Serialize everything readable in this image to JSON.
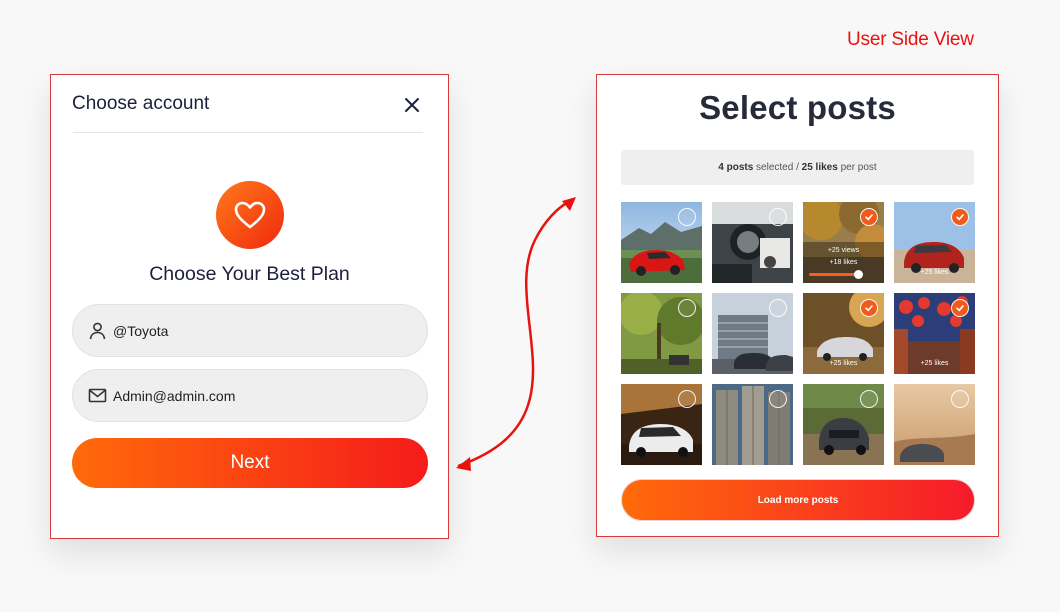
{
  "page": {
    "view_label": "User Side View"
  },
  "account_modal": {
    "title": "Choose account",
    "close_icon": "close-icon",
    "heart_icon": "heart-icon",
    "plan_heading": "Choose Your Best Plan",
    "username_value": "@Toyota",
    "username_icon": "user-icon",
    "email_value": "Admin@admin.com",
    "email_icon": "mail-icon",
    "next_label": "Next",
    "accent_gradient": [
      "#ff6a0a",
      "#f51b1b"
    ]
  },
  "posts_panel": {
    "title": "Select posts",
    "summary": {
      "count": "4 posts",
      "selected_word": " selected / ",
      "likes": "25 likes",
      "per_post": " per post"
    },
    "posts": [
      {
        "selected": false,
        "scene": "red sports car by lake",
        "caption": ""
      },
      {
        "selected": false,
        "scene": "car interior",
        "caption": ""
      },
      {
        "selected": true,
        "scene": "autumn trees",
        "views": "+25 views",
        "likes": "+18 likes",
        "slider": 0.9
      },
      {
        "selected": true,
        "scene": "red SUV",
        "caption": "+25 likes"
      },
      {
        "selected": false,
        "scene": "forest car",
        "caption": ""
      },
      {
        "selected": false,
        "scene": "building car",
        "caption": ""
      },
      {
        "selected": true,
        "scene": "desert car",
        "caption": "+25 likes"
      },
      {
        "selected": true,
        "scene": "red lanterns street",
        "caption": "+25 likes"
      },
      {
        "selected": false,
        "scene": "white SUV garage",
        "caption": ""
      },
      {
        "selected": false,
        "scene": "silos",
        "caption": ""
      },
      {
        "selected": false,
        "scene": "pickup on dirt road",
        "caption": ""
      },
      {
        "selected": false,
        "scene": "desert truck",
        "caption": ""
      }
    ],
    "load_more_label": "Load more posts",
    "check_color": "#f25a1c"
  }
}
